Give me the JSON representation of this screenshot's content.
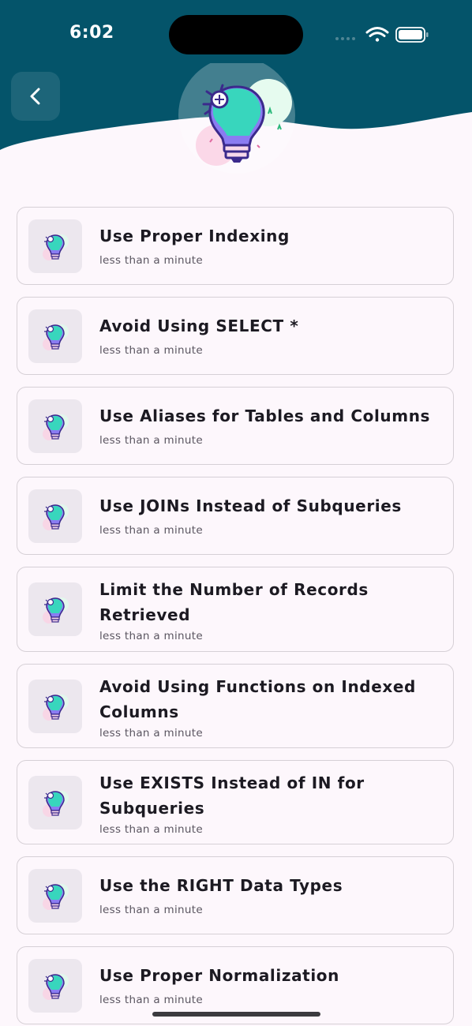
{
  "status_bar": {
    "time": "6:02"
  },
  "header": {
    "background_color": "#04546a",
    "back_icon": "chevron-left-icon",
    "hero_icon": "lightbulb-icon"
  },
  "items": [
    {
      "title": "Use Proper Indexing",
      "subtitle": "less than a minute",
      "icon": "lightbulb-icon"
    },
    {
      "title": "Avoid Using SELECT *",
      "subtitle": "less than a minute",
      "icon": "lightbulb-icon"
    },
    {
      "title": "Use Aliases for Tables and Columns",
      "subtitle": "less than a minute",
      "icon": "lightbulb-icon"
    },
    {
      "title": "Use JOINs Instead of Subqueries",
      "subtitle": "less than a minute",
      "icon": "lightbulb-icon"
    },
    {
      "title": "Limit the Number of Records Retrieved",
      "subtitle": "less than a minute",
      "icon": "lightbulb-icon"
    },
    {
      "title": "Avoid Using Functions on Indexed Columns",
      "subtitle": "less than a minute",
      "icon": "lightbulb-icon"
    },
    {
      "title": "Use EXISTS Instead of IN for Subqueries",
      "subtitle": "less than a minute",
      "icon": "lightbulb-icon"
    },
    {
      "title": "Use the RIGHT Data Types",
      "subtitle": "less than a minute",
      "icon": "lightbulb-icon"
    },
    {
      "title": "Use Proper Normalization",
      "subtitle": "less than a minute",
      "icon": "lightbulb-icon"
    }
  ]
}
